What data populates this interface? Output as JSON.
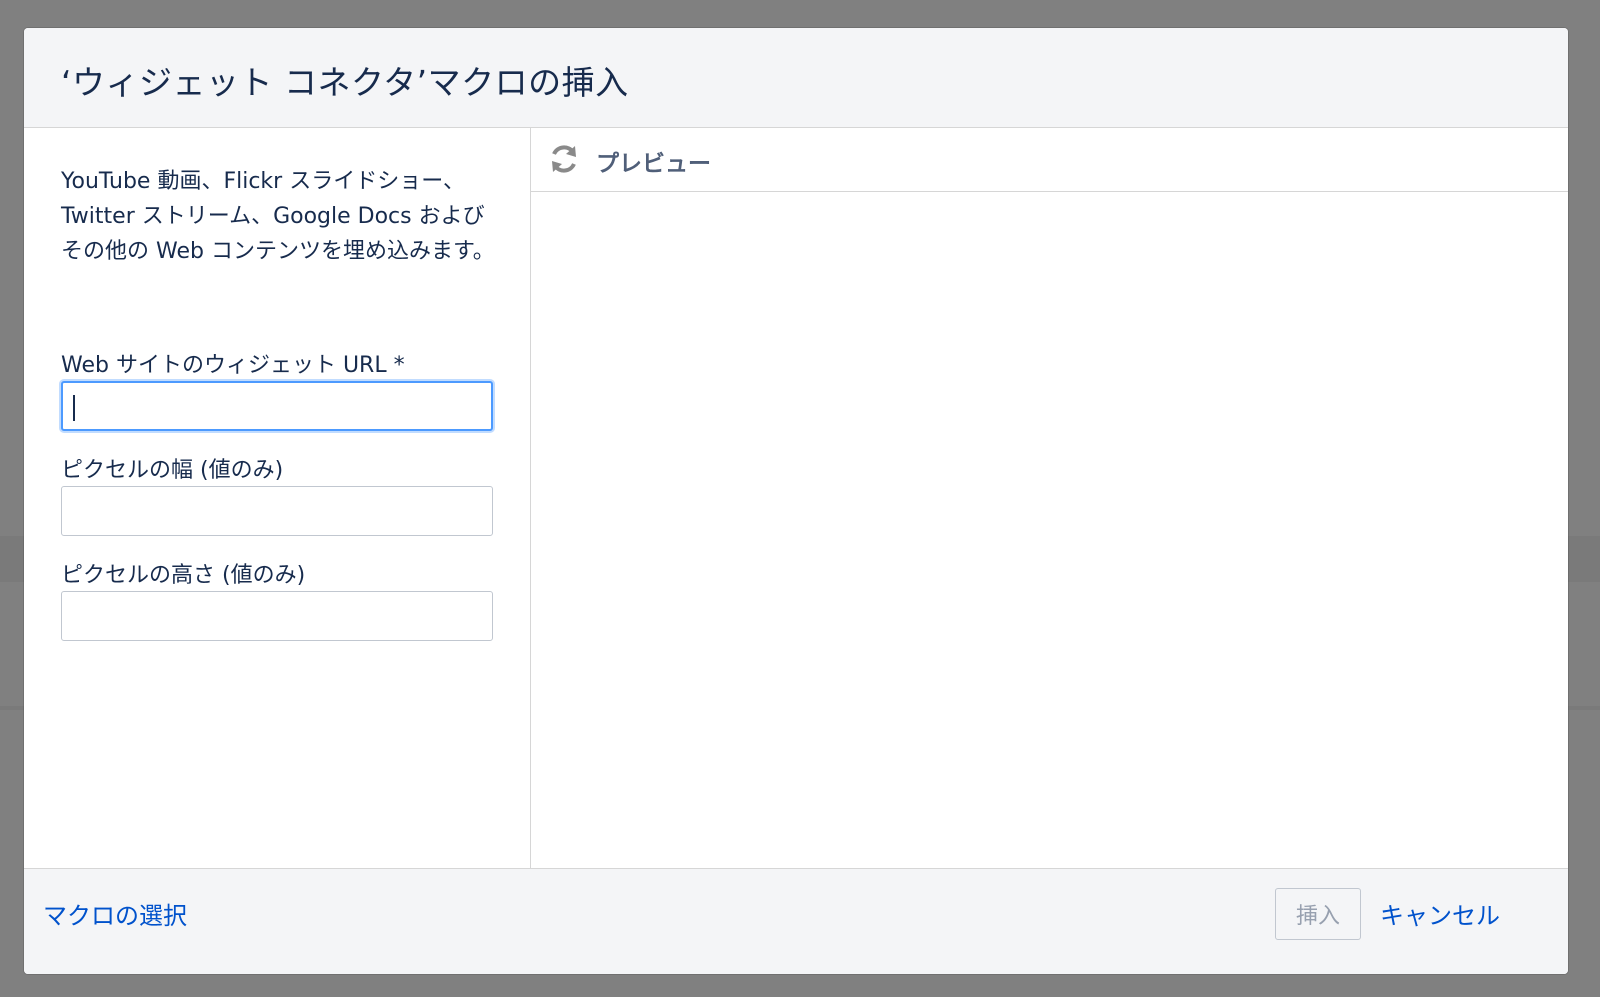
{
  "dialog": {
    "title": "‘ウィジェット コネクタ’マクロの挿入"
  },
  "form": {
    "description": "YouTube 動画、Flickr スライドショー、Twitter ストリーム、Google Docs およびその他の Web コンテンツを埋め込みます。",
    "url_field": {
      "label": "Web サイトのウィジェット URL *",
      "value": ""
    },
    "width_field": {
      "label": "ピクセルの幅 (値のみ)",
      "value": ""
    },
    "height_field": {
      "label": "ピクセルの高さ (値のみ)",
      "value": ""
    }
  },
  "preview": {
    "label": "プレビュー",
    "icon": "refresh-icon"
  },
  "footer": {
    "select_macro_label": "マクロの選択",
    "insert_label": "挿入",
    "cancel_label": "キャンセル"
  },
  "colors": {
    "link": "#0052cc",
    "focus_ring": "#4c9aff",
    "text": "#172b4d",
    "overlay": "#808080"
  }
}
